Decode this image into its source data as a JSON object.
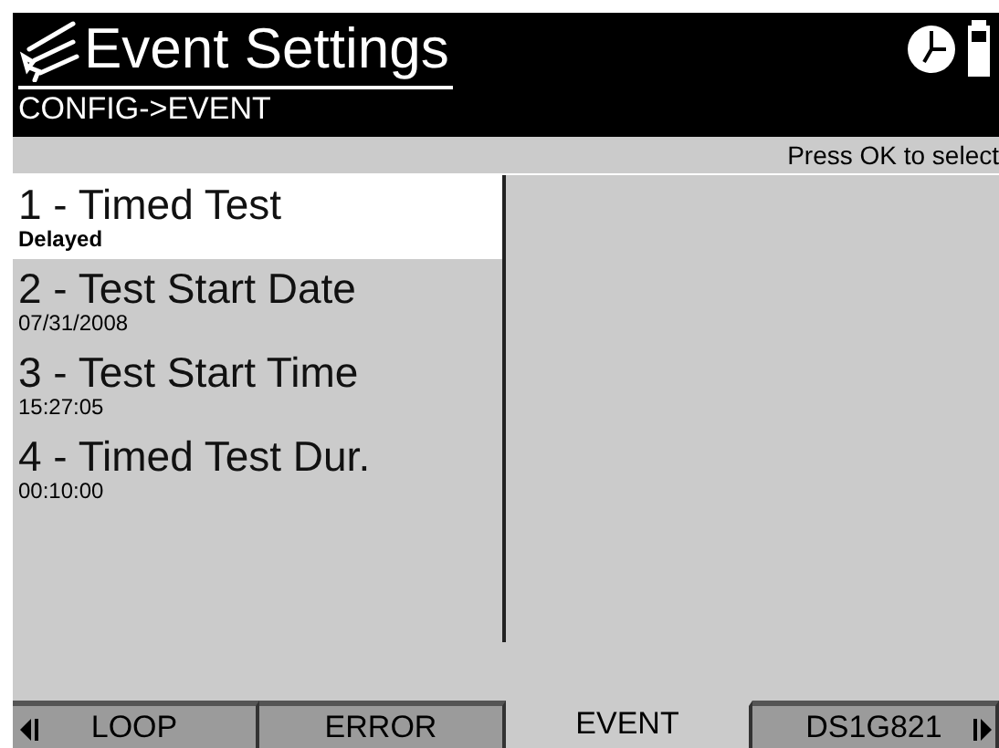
{
  "header": {
    "title": "Event Settings",
    "breadcrumb": "CONFIG->EVENT"
  },
  "hint": "Press OK to select",
  "items": [
    {
      "label": "1 - Timed Test",
      "value": "Delayed",
      "selected": true
    },
    {
      "label": "2 - Test Start Date",
      "value": "07/31/2008",
      "selected": false
    },
    {
      "label": "3 - Test Start Time",
      "value": "15:27:05",
      "selected": false
    },
    {
      "label": "4 - Timed Test Dur.",
      "value": "00:10:00",
      "selected": false
    }
  ],
  "tabs": [
    {
      "label": "LOOP",
      "selected": false
    },
    {
      "label": "ERROR",
      "selected": false
    },
    {
      "label": "EVENT",
      "selected": true
    },
    {
      "label": "DS1G821",
      "selected": false
    }
  ]
}
